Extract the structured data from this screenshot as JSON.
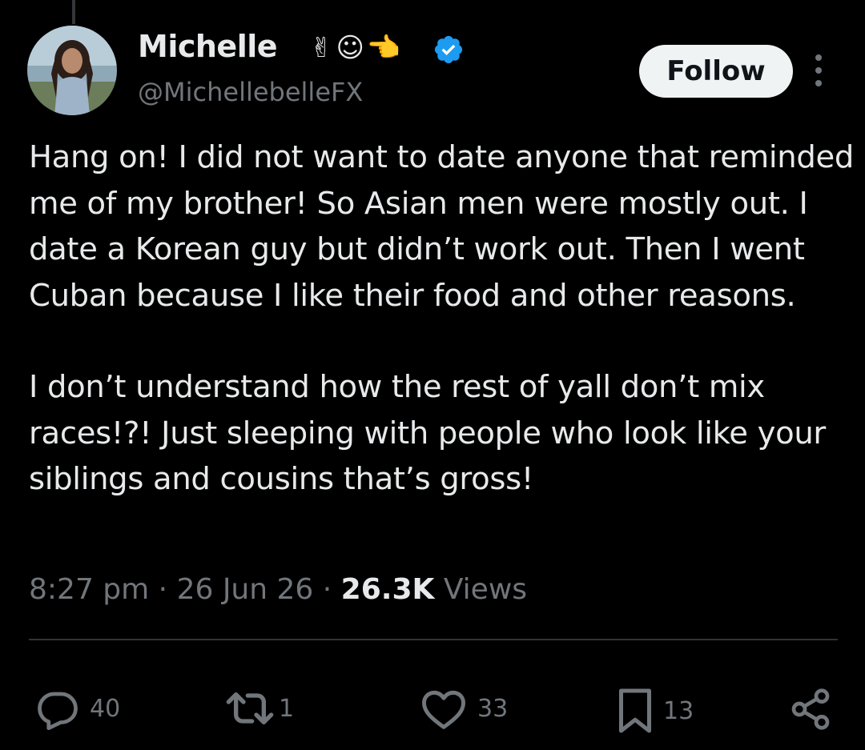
{
  "author": {
    "display_name": "Michelle",
    "emojis": [
      "✌",
      "☺",
      "👉"
    ],
    "verified": true,
    "handle": "@MichellebelleFX"
  },
  "follow_label": "Follow",
  "tweet": {
    "paragraphs": [
      "Hang on!  I did not want to date anyone that reminded me of my brother! So Asian men were mostly out.  I date a Korean guy but didn’t work out. Then I went Cuban because I like their food and other reasons.",
      "I don’t understand how the rest of yall don’t mix races!?! Just sleeping with people who look like your siblings and cousins that’s gross!"
    ]
  },
  "meta": {
    "time": "8:27 pm",
    "separator": " · ",
    "date": "26 Jun 26",
    "views_count": "26.3K",
    "views_label": " Views"
  },
  "actions": {
    "replies": "40",
    "reposts": "1",
    "likes": "33",
    "bookmarks": "13"
  },
  "colors": {
    "background": "#000000",
    "text": "#e7e9ea",
    "secondary": "#71767b",
    "verified": "#1d9bf0",
    "follow_bg": "#eff3f4"
  }
}
